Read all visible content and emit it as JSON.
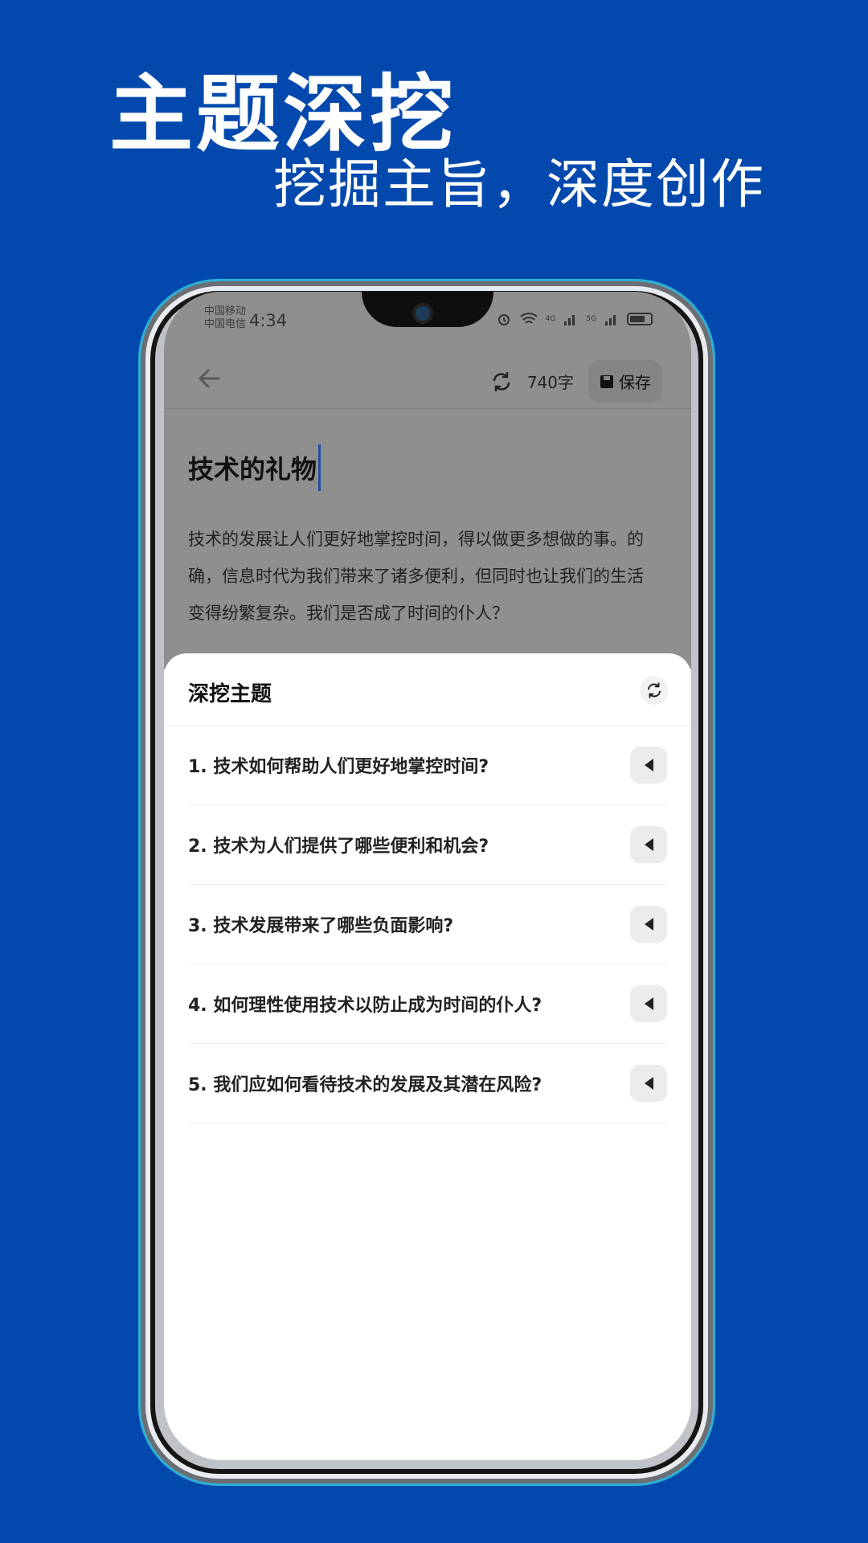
{
  "hero": {
    "title": "主题深挖",
    "subtitle": "挖掘主旨，深度创作"
  },
  "status_bar": {
    "carrier_1": "中国移动",
    "carrier_2": "中国电信",
    "time": "4:34",
    "signal_1": "4G",
    "signal_2": "5G"
  },
  "toolbar": {
    "word_count": "740字",
    "save_label": "保存"
  },
  "document": {
    "title": "技术的礼物",
    "body": "技术的发展让人们更好地掌控时间，得以做更多想做的事。的确，信息时代为我们带来了诸多便利，但同时也让我们的生活变得纷繁复杂。我们是否成了时间的仆人？"
  },
  "sheet": {
    "title": "深挖主题",
    "topics": [
      "1. 技术如何帮助人们更好地掌控时间?",
      "2. 技术为人们提供了哪些便利和机会?",
      "3. 技术发展带来了哪些负面影响?",
      "4. 如何理性使用技术以防止成为时间的仆人?",
      "5. 我们应如何看待技术的发展及其潜在风险?"
    ]
  },
  "colors": {
    "background": "#0349ad",
    "dim_overlay": "#8f8f8f",
    "caret": "#1b4fa0"
  }
}
